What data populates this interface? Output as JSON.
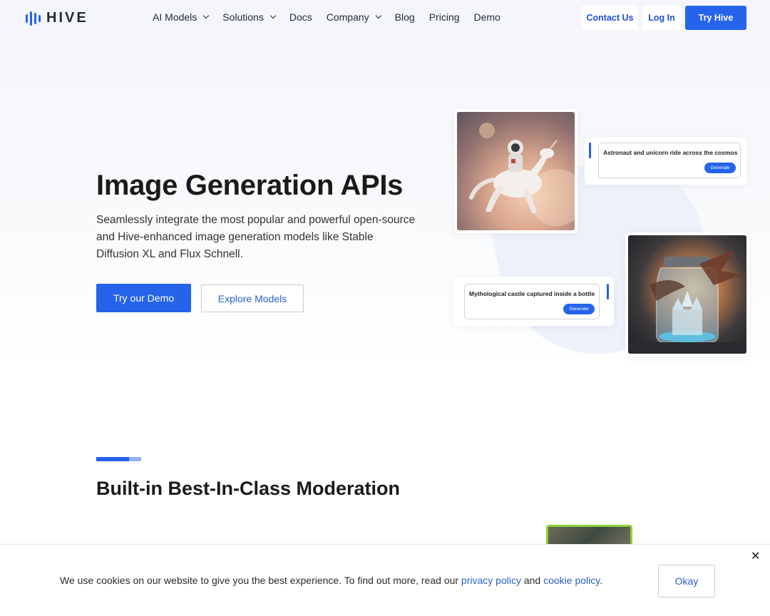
{
  "brand": {
    "name": "HIVE",
    "color": "#2563eb"
  },
  "nav": {
    "items": [
      {
        "label": "AI Models",
        "dropdown": true
      },
      {
        "label": "Solutions",
        "dropdown": true
      },
      {
        "label": "Docs",
        "dropdown": false
      },
      {
        "label": "Company",
        "dropdown": true
      },
      {
        "label": "Blog",
        "dropdown": false
      },
      {
        "label": "Pricing",
        "dropdown": false
      },
      {
        "label": "Demo",
        "dropdown": false
      }
    ],
    "contact_label": "Contact Us",
    "login_label": "Log In",
    "try_label": "Try Hive"
  },
  "hero": {
    "title": "Image Generation APIs",
    "description": "Seamlessly integrate the most popular and powerful open-source and Hive-enhanced image generation models like Stable Diffusion XL and Flux Schnell.",
    "primary_cta": "Try our Demo",
    "secondary_cta": "Explore Models"
  },
  "collage": {
    "prompt_1": "Astronaut and unicorn ride across the cosmos",
    "prompt_2": "Mythological castle captured inside a bottle",
    "generate_label": "Generate"
  },
  "section2": {
    "title": "Built-in Best-In-Class Moderation"
  },
  "cookie": {
    "text_before": "We use cookies on our website to give you the best experience. To find out more, read our ",
    "privacy_link": "privacy policy",
    "text_middle": " and ",
    "cookie_link": "cookie policy",
    "text_after": ".",
    "okay_label": "Okay",
    "close_icon": "close-icon"
  }
}
